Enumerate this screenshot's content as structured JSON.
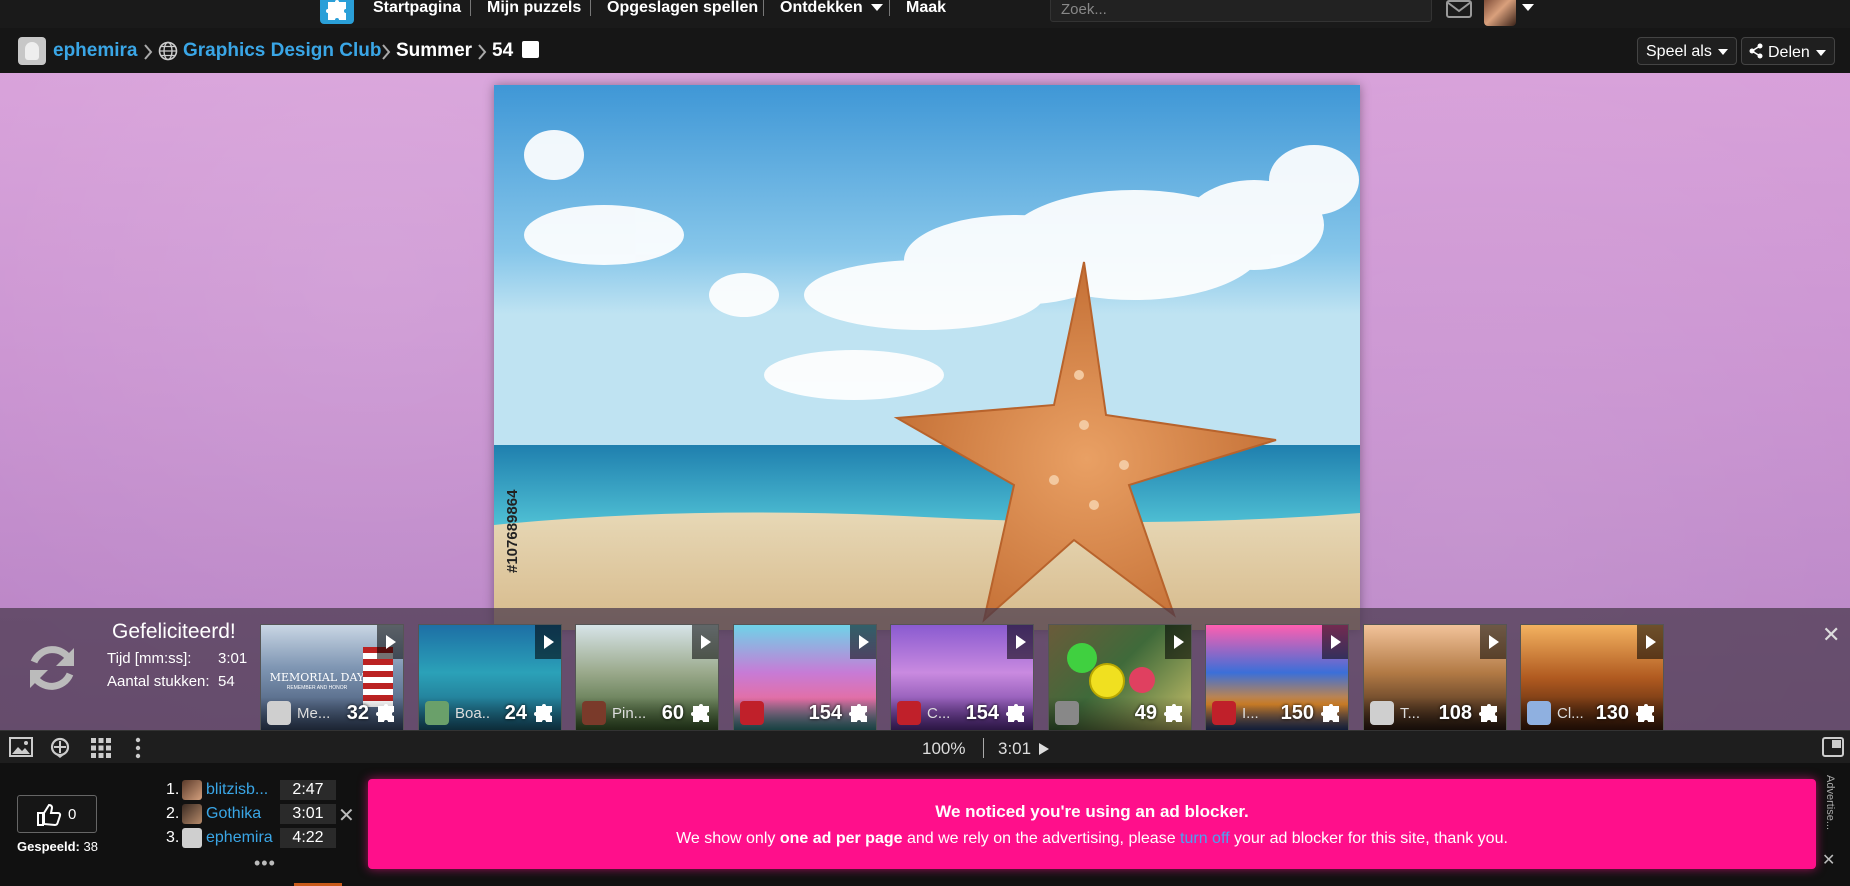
{
  "nav": {
    "items": [
      "Startpagina",
      "Mijn puzzels",
      "Opgeslagen spellen",
      "Ontdekken",
      "Maak"
    ],
    "search_placeholder": "Zoek..."
  },
  "breadcrumb": {
    "user": "ephemira",
    "club": "Graphics Design Club",
    "title": "Summer",
    "pieces": "54",
    "play_as": "Speel als",
    "share": "Delen"
  },
  "puzzle": {
    "stock_id": "#107689864"
  },
  "congrats": {
    "title": "Gefeliciteerd!",
    "time_label": "Tijd [mm:ss]:",
    "time_value": "3:01",
    "pieces_label": "Aantal stukken:",
    "pieces_value": "54"
  },
  "suggestions": [
    {
      "name": "Me...",
      "count": "32"
    },
    {
      "name": "Boa...",
      "count": "24"
    },
    {
      "name": "Pin...",
      "count": "60"
    },
    {
      "name": "",
      "count": "154"
    },
    {
      "name": "C...",
      "count": "154"
    },
    {
      "name": "",
      "count": "49"
    },
    {
      "name": "I...",
      "count": "150"
    },
    {
      "name": "T...",
      "count": "108"
    },
    {
      "name": "Cl...",
      "count": "130"
    }
  ],
  "thumb_texts": {
    "memorial": "MEMORIAL DAY",
    "memorial_sub": "REMEMBER AND HONOR"
  },
  "controls": {
    "zoom": "100%",
    "time": "3:01"
  },
  "bottom": {
    "likes": "0",
    "played_label": "Gespeeld:",
    "played_count": "38",
    "leaderboard": [
      {
        "rank": "1.",
        "name": "blitzisb...",
        "time": "2:47"
      },
      {
        "rank": "2.",
        "name": "Gothika",
        "time": "3:01"
      },
      {
        "rank": "3.",
        "name": "ephemira",
        "time": "4:22"
      }
    ],
    "more": "•••"
  },
  "ad": {
    "title": "We noticed you're using an ad blocker.",
    "text_before": "We show only ",
    "text_bold": "one ad per page",
    "text_mid": " and we rely on the advertising, please ",
    "link": "turn off",
    "text_after": " your ad blocker for this site, thank you.",
    "side_label": "Advertise..."
  },
  "colors": {
    "link": "#3aa6e6",
    "ad_bg": "#ff0f8b",
    "stage_bg": "#c78fcf"
  }
}
